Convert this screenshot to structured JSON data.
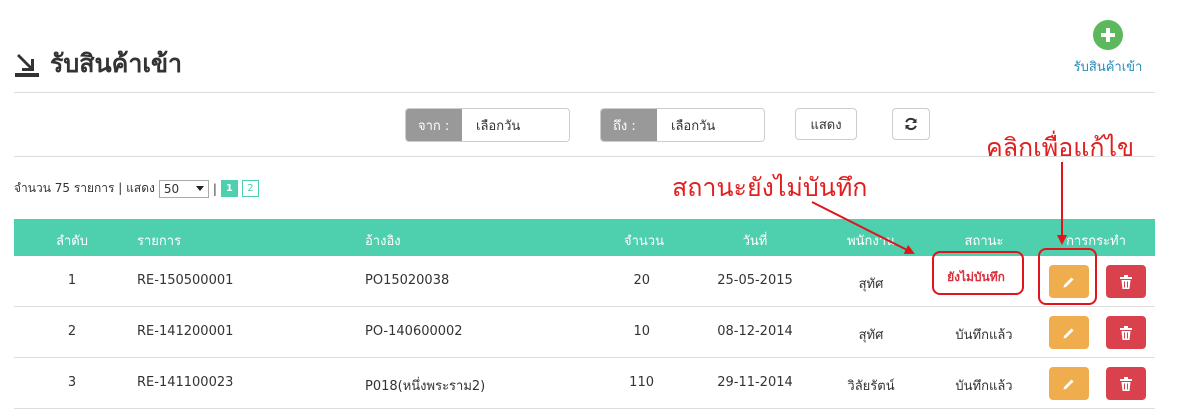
{
  "header": {
    "title": "รับสินค้าเข้า",
    "add_label": "รับสินค้าเข้า"
  },
  "filter": {
    "from_label": "จาก :",
    "from_placeholder": "เลือกวัน",
    "to_label": "ถึง :",
    "to_placeholder": "เลือกวัน",
    "show_label": "แสดง"
  },
  "info": {
    "count_text": "จำนวน 75 รายการ | แสดง",
    "per_page": "50",
    "sep": "|",
    "pages": [
      "1",
      "2"
    ]
  },
  "table": {
    "columns": [
      "ลำดับ",
      "รายการ",
      "อ้างอิง",
      "จำนวน",
      "วันที่",
      "พนักงาน",
      "สถานะ",
      "การกระทำ"
    ],
    "rows": [
      {
        "no": "1",
        "code": "RE-150500001",
        "ref": "PO15020038",
        "qty": "20",
        "date": "25-05-2015",
        "staff": "สุทัศ",
        "status": "ยังไม่บันทึก"
      },
      {
        "no": "2",
        "code": "RE-141200001",
        "ref": "PO-140600002",
        "qty": "10",
        "date": "08-12-2014",
        "staff": "สุทัศ",
        "status": "บันทึกแล้ว"
      },
      {
        "no": "3",
        "code": "RE-141100023",
        "ref": "P018(หนึ่งพระราม2)",
        "qty": "110",
        "date": "29-11-2014",
        "staff": "วิลัยรัตน์",
        "status": "บันทึกแล้ว"
      }
    ]
  },
  "annotations": {
    "status_note": "สถานะยังไม่บันทึก",
    "edit_note": "คลิกเพื่อแก้ไข"
  },
  "colors": {
    "table_header": "#4ecfae",
    "edit_button": "#f0ad4e",
    "delete_button": "#d9424d",
    "add_button": "#5cb85c",
    "annotation": "#e02020"
  },
  "icons": [
    "import-arrow-icon",
    "plus-circle-icon",
    "refresh-icon",
    "pencil-icon",
    "trash-icon",
    "caret-down-icon"
  ]
}
